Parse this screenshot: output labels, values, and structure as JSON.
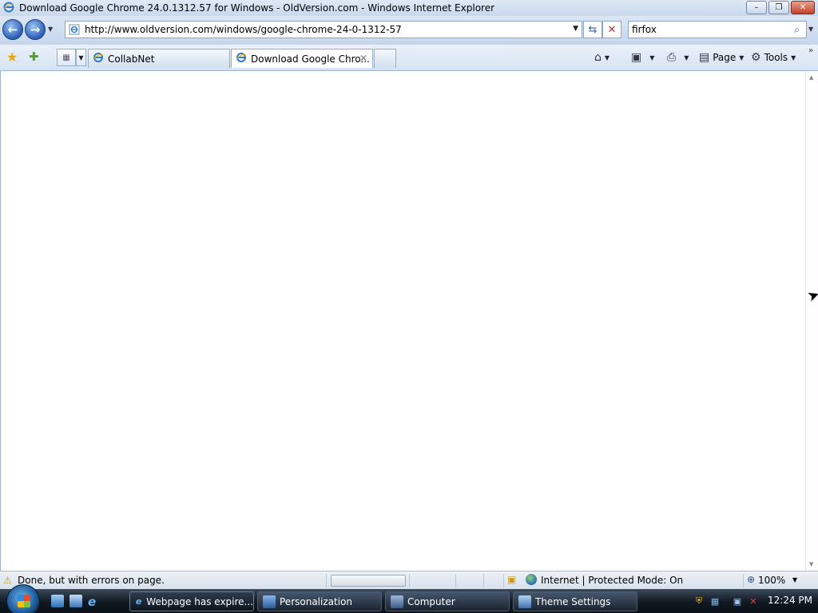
{
  "window": {
    "title": "Download Google Chrome 24.0.1312.57 for Windows - OldVersion.com - Windows Internet Explorer",
    "minimize_label": "–",
    "restore_label": "❐",
    "close_label": "✕"
  },
  "toolbar": {
    "back_label": "←",
    "forward_label": "→",
    "address_url": "http://www.oldversion.com/windows/google-chrome-24-0-1312-57",
    "search_value": "firfox",
    "refresh_label": "⇆",
    "stop_label": "✕"
  },
  "tabs": [
    {
      "label": "CollabNet"
    },
    {
      "label": "Download Google Chro..."
    }
  ],
  "commands": {
    "page_label": "Page",
    "tools_label": "Tools"
  },
  "status": {
    "text": "Done, but with errors on page.",
    "zone": "Internet | Protected Mode: On",
    "zoom": "100%"
  },
  "taskbar": {
    "tasks": [
      {
        "label": "Webpage has expire..."
      },
      {
        "label": "Personalization"
      },
      {
        "label": "Computer"
      },
      {
        "label": "Theme Settings"
      }
    ],
    "clock": "12:24 PM"
  },
  "icons": {
    "browser": "ie-icon",
    "favorites": "star-icon",
    "add_favorites": "add-favorite-icon",
    "home": "home-icon",
    "feeds": "rss-icon",
    "print": "printer-icon",
    "warning": "warning-icon",
    "globe": "globe-icon"
  },
  "colors": {
    "chrome_blue": "#c9d8ec",
    "taskbar_dark": "#101820",
    "ie_blue": "#2a5fb8"
  }
}
